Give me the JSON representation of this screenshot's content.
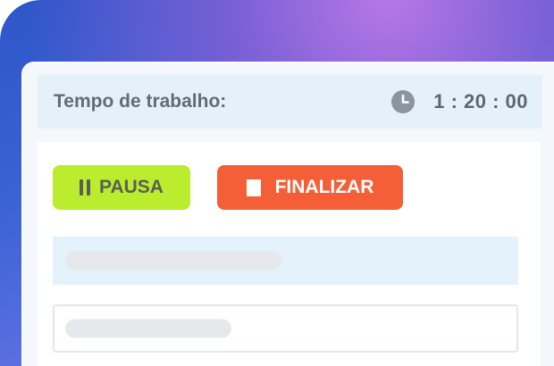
{
  "timer_card": {
    "title": "Tempo de trabalho:",
    "time": "1 : 20 : 00",
    "icon": "clock-icon"
  },
  "actions": {
    "pause_label": "PAUSA",
    "pause_icon": "pause-icon",
    "finish_label": "FINALIZAR",
    "finish_icon": "stop-icon"
  },
  "colors": {
    "pause_button": "#bbec2d",
    "finish_button": "#f45f38",
    "header_bg": "#e4f1fb",
    "background_gradient_start": "#2f56c8",
    "background_gradient_end": "#b878e6"
  }
}
